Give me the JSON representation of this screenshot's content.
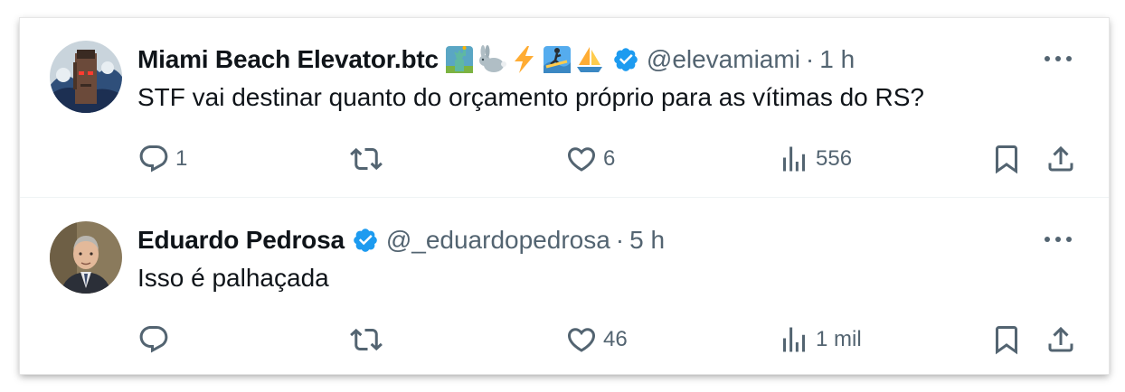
{
  "tweets": [
    {
      "author_name": "Miami Beach Elevator.btc",
      "emojis": [
        "statue-of-liberty",
        "rabbit",
        "lightning",
        "surfer",
        "sailboat"
      ],
      "verified": true,
      "handle": "@elevamiami",
      "separator": "·",
      "time": "1 h",
      "text": "STF vai destinar quanto do orçamento próprio para as vítimas do RS?",
      "stats": {
        "replies": "1",
        "retweets": "",
        "likes": "6",
        "views": "556"
      }
    },
    {
      "author_name": "Eduardo Pedrosa",
      "emojis": [],
      "verified": true,
      "handle": "@_eduardopedrosa",
      "separator": "·",
      "time": "5 h",
      "text": "Isso é palhaçada",
      "stats": {
        "replies": "",
        "retweets": "",
        "likes": "46",
        "views": "1 mil"
      }
    }
  ],
  "colors": {
    "text_primary": "#0f1419",
    "text_secondary": "#536471",
    "verified_blue": "#1d9bf0",
    "divider": "#eff3f4"
  },
  "icons": [
    "reply-icon",
    "retweet-icon",
    "like-icon",
    "views-icon",
    "bookmark-icon",
    "share-icon",
    "more-icon",
    "verified-badge-icon"
  ]
}
